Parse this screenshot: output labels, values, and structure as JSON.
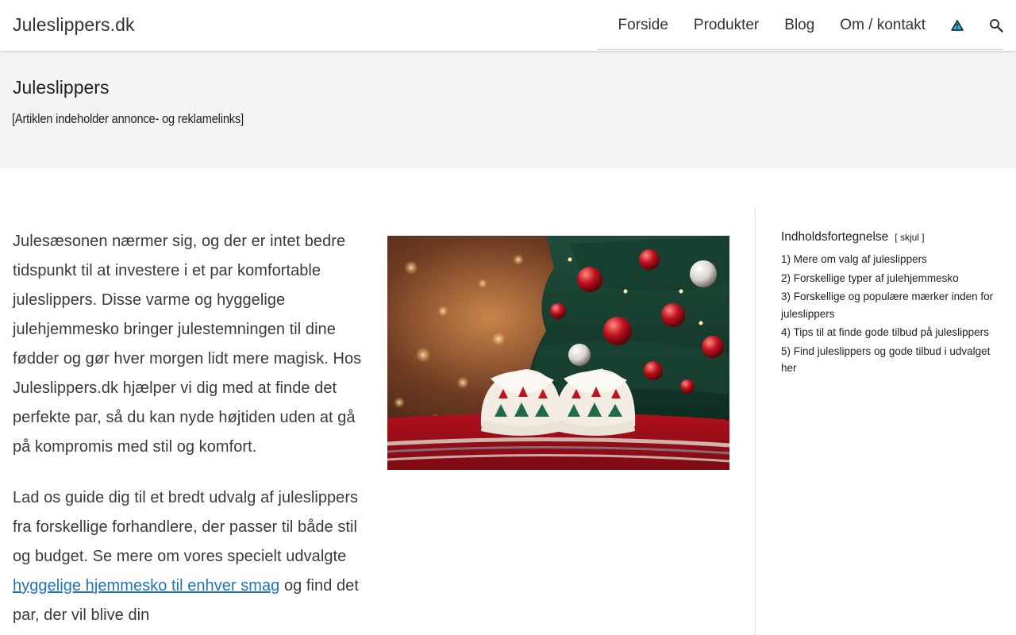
{
  "header": {
    "logo": "Juleslippers.dk",
    "nav": [
      "Forside",
      "Produkter",
      "Blog",
      "Om / kontakt"
    ],
    "icons": [
      "warning-triangle-icon",
      "search-icon"
    ]
  },
  "title_band": {
    "title": "Juleslippers",
    "ad_note": "[Artiklen indeholder annonce- og reklamelinks]"
  },
  "article": {
    "para1": "Julesæsonen nærmer sig, og der er intet bedre tidspunkt til at investere i et par komfortable juleslippers. Disse varme og hyggelige julehjemmesko bringer julestemningen til dine fødder og gør hver morgen lidt mere magisk. Hos Juleslippers.dk hjælper vi dig med at finde det perfekte par, så du kan nyde højtiden uden at gå på kompromis med stil og komfort.",
    "para2_before": "Lad os guide dig til et bredt udvalg af juleslippers fra forskellige forhandlere, der passer til både stil og budget. Se mere om vores specielt udvalgte ",
    "para2_link": "hyggelige hjemmesko til enhver smag",
    "para2_after": " og find det par, der vil blive din"
  },
  "toc": {
    "heading": "Indholdsfortegnelse",
    "toggle": "[ skjul ]",
    "items": [
      "1) Mere om valg af juleslippers",
      "2) Forskellige typer af julehjemmesko",
      "3) Forskellige og populære mærker inden for juleslippers",
      "4) Tips til at finde gode tilbud på juleslippers",
      "5) Find juleslippers og gode tilbud i udvalget her"
    ]
  },
  "colors": {
    "link": "#1e73be",
    "title_band_bg": "#f4f4f4",
    "warning_icon_fill": "#29b6d9"
  }
}
